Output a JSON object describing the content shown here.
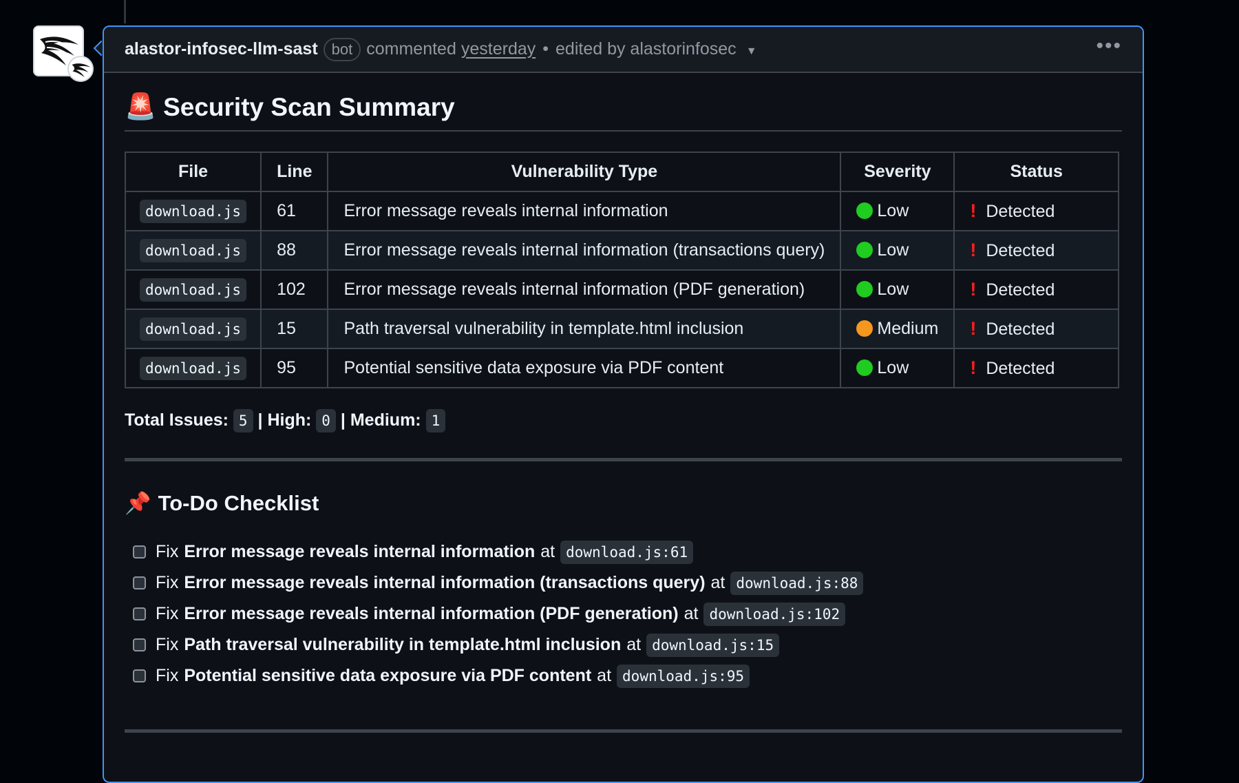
{
  "comment": {
    "author": "alastor-infosec-llm-sast",
    "bot_label": "bot",
    "action": "commented",
    "time": "yesterday",
    "edited_by": "edited by alastorinfosec"
  },
  "summary": {
    "title": "Security Scan Summary",
    "emoji": "🚨",
    "columns": [
      "File",
      "Line",
      "Vulnerability Type",
      "Severity",
      "Status"
    ],
    "rows": [
      {
        "file": "download.js",
        "line": "61",
        "type": "Error message reveals internal information",
        "severity": "Low",
        "severity_color": "#1fcc1f",
        "status": "Detected"
      },
      {
        "file": "download.js",
        "line": "88",
        "type": "Error message reveals internal information (transactions query)",
        "severity": "Low",
        "severity_color": "#1fcc1f",
        "status": "Detected"
      },
      {
        "file": "download.js",
        "line": "102",
        "type": "Error message reveals internal information (PDF generation)",
        "severity": "Low",
        "severity_color": "#1fcc1f",
        "status": "Detected"
      },
      {
        "file": "download.js",
        "line": "15",
        "type": "Path traversal vulnerability in template.html inclusion",
        "severity": "Medium",
        "severity_color": "#f7971e",
        "status": "Detected"
      },
      {
        "file": "download.js",
        "line": "95",
        "type": "Potential sensitive data exposure via PDF content",
        "severity": "Low",
        "severity_color": "#1fcc1f",
        "status": "Detected"
      }
    ],
    "status_mark": "!",
    "totals": {
      "total_label": "Total Issues:",
      "total": "5",
      "high_label": "| High:",
      "high": "0",
      "medium_label": "| Medium:",
      "medium": "1"
    }
  },
  "checklist": {
    "title": "To-Do Checklist",
    "emoji": "📌",
    "prefix": "Fix",
    "at": "at",
    "items": [
      {
        "text": "Error message reveals internal information",
        "loc": "download.js:61"
      },
      {
        "text": "Error message reveals internal information (transactions query)",
        "loc": "download.js:88"
      },
      {
        "text": "Error message reveals internal information (PDF generation)",
        "loc": "download.js:102"
      },
      {
        "text": "Path traversal vulnerability in template.html inclusion",
        "loc": "download.js:15"
      },
      {
        "text": "Potential sensitive data exposure via PDF content",
        "loc": "download.js:95"
      }
    ]
  }
}
